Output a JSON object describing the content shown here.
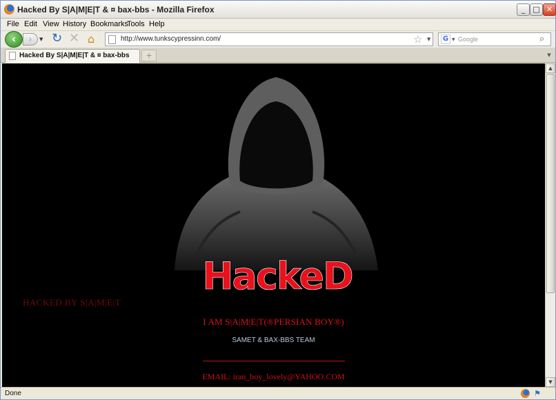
{
  "window": {
    "title": "Hacked By S|A|M|E|T & ¤ bax-bbs - Mozilla Firefox",
    "minimize_label": "_",
    "maximize_label": "□",
    "close_label": "✕"
  },
  "menu": {
    "items": [
      "File",
      "Edit",
      "View",
      "History",
      "Bookmarks",
      "Tools",
      "Help"
    ]
  },
  "nav": {
    "url": "http://www.tunkscypressinn.com/",
    "search_placeholder": "Google",
    "search_engine_glyph": "G"
  },
  "tabs": {
    "active_label": "Hacked By S|A|M|E|T & ¤ bax-bbs",
    "new_tab_label": "+"
  },
  "page": {
    "sidebar_text": "HACKED BY S|A|M|E|T",
    "logo_text": "HackeD",
    "heading": "I AM S|A|M|E|T(®PERSIAN BOY®)",
    "team": "SAMET & BAX-BBS TEAM",
    "email": "EMAIL: iran_boy_lovely@YAHOO.COM"
  },
  "status": {
    "text": "Done"
  },
  "colors": {
    "accent_red": "#e0101a",
    "background": "#000000",
    "team_text": "#b9c8e3"
  },
  "icons": {
    "back": "back-arrow-icon",
    "forward": "forward-arrow-icon",
    "reload": "reload-icon",
    "stop": "stop-icon",
    "home": "home-icon",
    "bookmark": "star-icon",
    "search": "magnifier-icon"
  }
}
